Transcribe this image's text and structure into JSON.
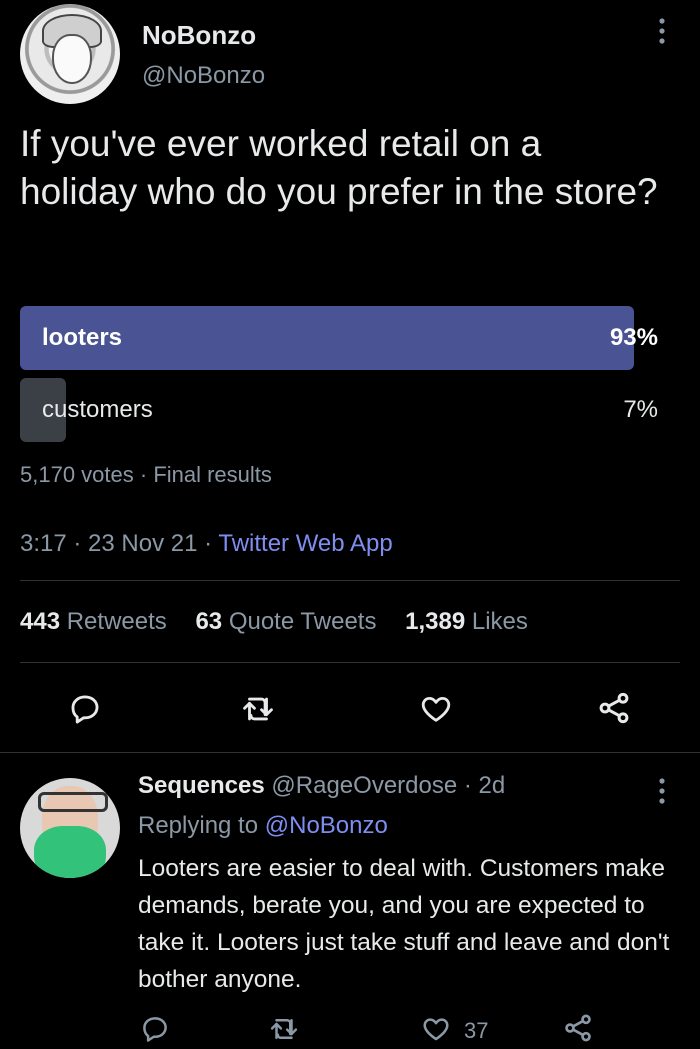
{
  "tweet": {
    "author_name": "NoBonzo",
    "author_handle": "@NoBonzo",
    "text": "If you've ever worked retail on a holiday who do you prefer in the store?",
    "poll": {
      "options": [
        {
          "label": "looters",
          "percent_text": "93%",
          "percent": 93
        },
        {
          "label": "customers",
          "percent_text": "7%",
          "percent": 7
        }
      ],
      "votes": "5,170 votes",
      "meta_sep": " · ",
      "status": "Final results"
    },
    "time": "3:17",
    "date": "23 Nov 21",
    "app": "Twitter Web App",
    "dot": " · ",
    "stats": {
      "retweets_count": "443",
      "retweets_label": "Retweets",
      "quotes_count": "63",
      "quotes_label": "Quote Tweets",
      "likes_count": "1,389",
      "likes_label": "Likes"
    }
  },
  "reply": {
    "author_name": "Sequences",
    "author_handle": "@RageOverdose",
    "age": "2d",
    "dot": " · ",
    "replying_prefix": "Replying to",
    "replying_to": "@NoBonzo",
    "text": "Looters are easier to deal with. Customers make demands, berate you, and you are expected to take it. Looters just take stuff and leave and don't bother anyone.",
    "like_count": "37"
  },
  "icons": {
    "more": "more-vertical-icon",
    "reply": "reply-icon",
    "retweet": "retweet-icon",
    "like": "heart-icon",
    "share": "share-icon"
  },
  "colors": {
    "background": "#000000",
    "text": "#e7e9ea",
    "muted": "#8b98a5",
    "link": "#7d8ef0",
    "poll_leading": "#4a5394",
    "poll_other": "#3b4046"
  }
}
